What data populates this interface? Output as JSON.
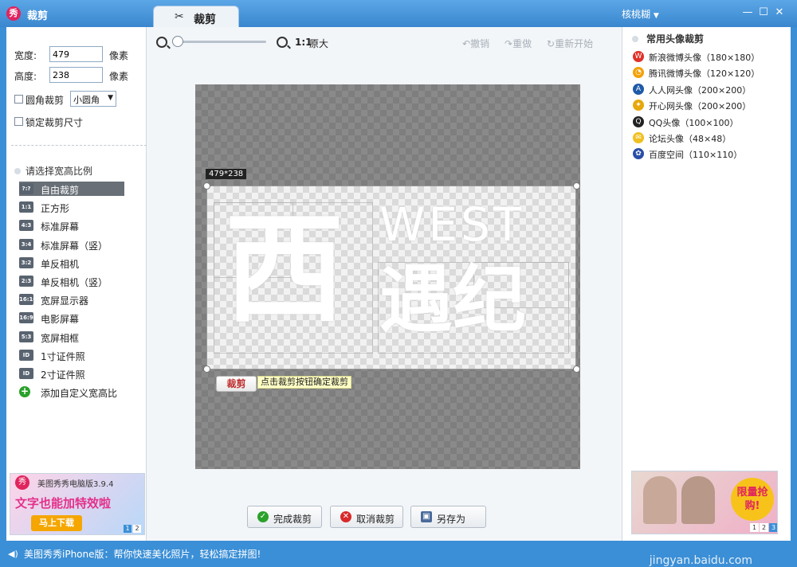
{
  "titlebar": {
    "app_title": "裁剪",
    "active_tab": "裁剪",
    "user": "核桃糊",
    "user_arrow": "▼",
    "minimize": "—",
    "maximize": "☐",
    "close": "✕"
  },
  "left_panel": {
    "width_label": "宽度:",
    "width_value": "479",
    "width_unit": "像素",
    "height_label": "高度:",
    "height_value": "238",
    "height_unit": "像素",
    "round_corner_label": "圆角裁剪",
    "round_corner_option": "小圆角",
    "lock_size_label": "锁定裁剪尺寸",
    "ratio_title": "请选择宽高比例",
    "ratios": [
      {
        "icon": "?:?",
        "label": "自由裁剪",
        "selected": true
      },
      {
        "icon": "1:1",
        "label": "正方形"
      },
      {
        "icon": "4:3",
        "label": "标准屏幕"
      },
      {
        "icon": "3:4",
        "label": "标准屏幕（竖）"
      },
      {
        "icon": "3:2",
        "label": "单反相机"
      },
      {
        "icon": "2:3",
        "label": "单反相机（竖）"
      },
      {
        "icon": "16:10",
        "label": "宽屏显示器"
      },
      {
        "icon": "16:9",
        "label": "电影屏幕"
      },
      {
        "icon": "5:3",
        "label": "宽屏相框"
      },
      {
        "icon": "ID",
        "label": "1寸证件照"
      },
      {
        "icon": "ID",
        "label": "2寸证件照"
      },
      {
        "icon": "+",
        "label": "添加自定义宽高比"
      }
    ],
    "ad": {
      "badge": "秀",
      "title": "美图秀秀电脑版3.9.4",
      "slogan": "文字也能加特效啦",
      "button": "马上下载",
      "page1": "1",
      "page2": "2"
    }
  },
  "toolbar": {
    "ratio_text": "1:1",
    "original_text": "原大",
    "undo": "撤销",
    "redo": "重做",
    "restart": "重新开始"
  },
  "canvas": {
    "dims_badge": "479*238",
    "art_char": "西",
    "art_west": "WEST",
    "art_yuji": "遇纪",
    "crop_button": "裁剪",
    "crop_tip": "点击裁剪按钮确定裁剪"
  },
  "bottom_buttons": {
    "finish": "完成裁剪",
    "cancel": "取消裁剪",
    "save_as": "另存为"
  },
  "right_panel": {
    "title": "常用头像裁剪",
    "presets": [
      {
        "label": "新浪微博头像（180×180）",
        "color": "#e0302a"
      },
      {
        "label": "腾讯微博头像（120×120）",
        "color": "#f2a20a"
      },
      {
        "label": "人人网头像（200×200）",
        "color": "#1e5aa8"
      },
      {
        "label": "开心网头像（200×200）",
        "color": "#e6a80c"
      },
      {
        "label": "QQ头像（100×100）",
        "color": "#222222"
      },
      {
        "label": "论坛头像（48×48）",
        "color": "#f0c020"
      },
      {
        "label": "百度空间（110×110）",
        "color": "#2a4ea8"
      }
    ],
    "ad": {
      "badge": "限量抢购!",
      "page1": "1",
      "page2": "2",
      "page3": "3"
    }
  },
  "statusbar": {
    "text": "美图秀秀iPhone版：帮你快速美化照片，轻松搞定拼图!",
    "watermark": "jingyan.baidu.com"
  }
}
